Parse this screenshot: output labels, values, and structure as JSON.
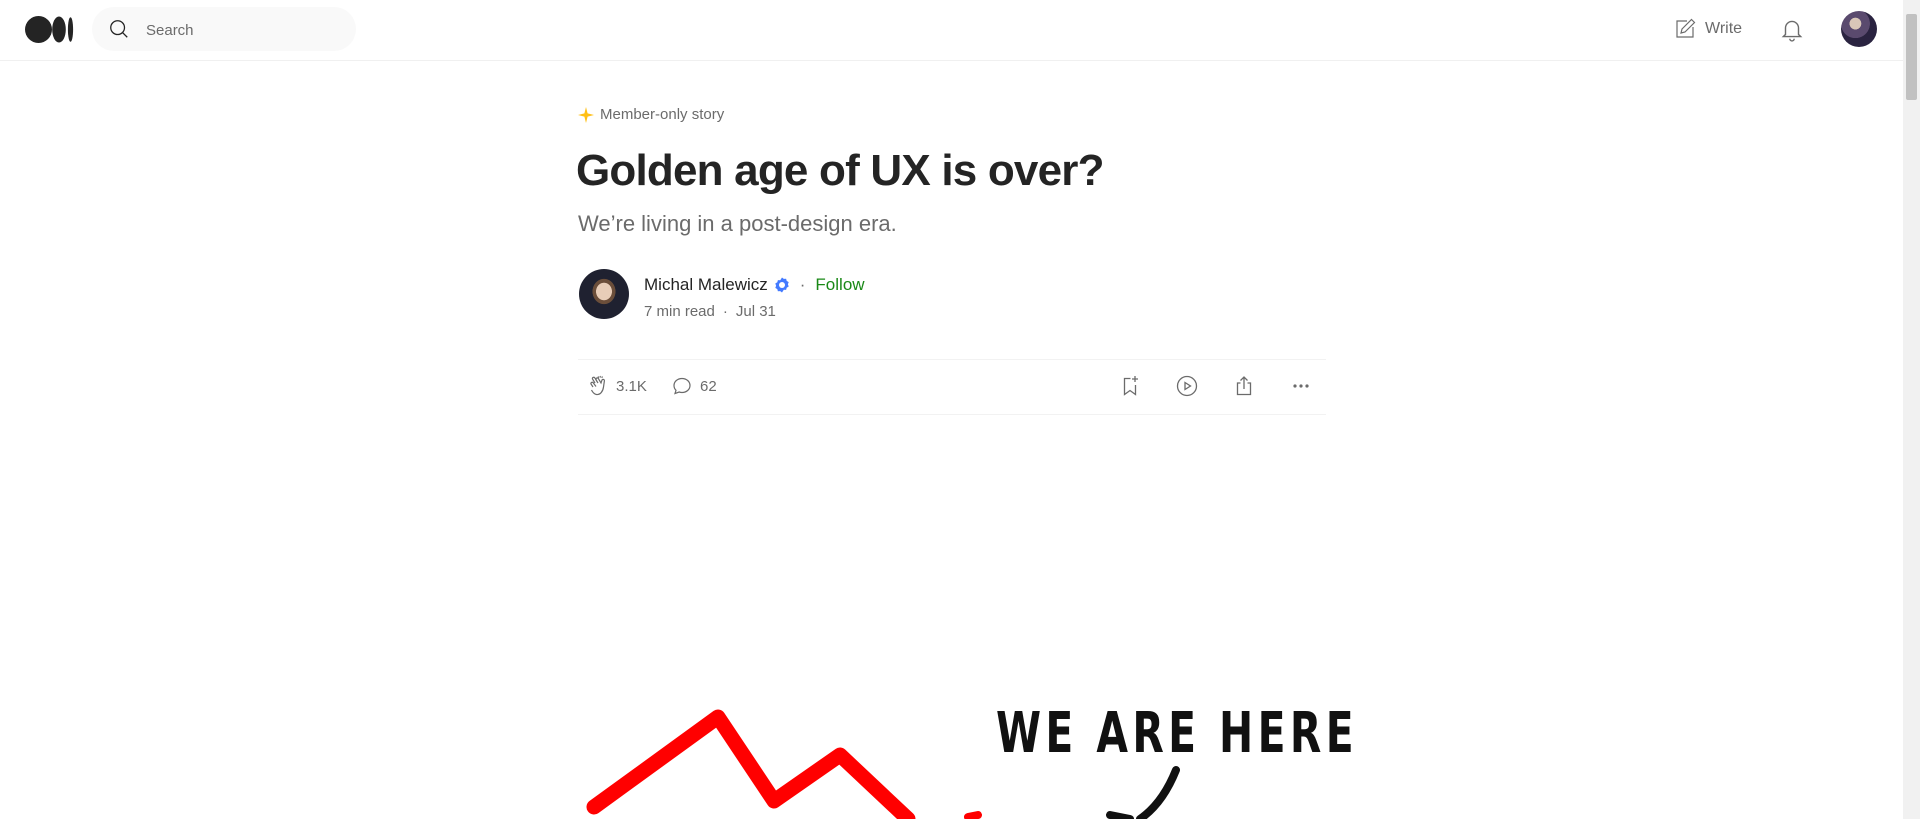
{
  "header": {
    "logo_icon": "medium-logo-icon",
    "search": {
      "placeholder": "Search"
    },
    "write_label": "Write"
  },
  "article": {
    "badge": "Member-only story",
    "title": "Golden age of UX is over?",
    "subtitle": "We’re living in a post-design era.",
    "author": {
      "name": "Michal Malewicz",
      "follow_label": "Follow",
      "separator": "·",
      "read_time": "7 min read",
      "date": "Jul 31"
    },
    "actions": {
      "claps": "3.1K",
      "responses": "62"
    },
    "hero_image": {
      "text": "WE ARE HERE",
      "line_color": "#ff0000"
    }
  },
  "colors": {
    "accent_follow": "#1a8917",
    "member_star": "#ffc017",
    "verified": "#437aff"
  }
}
